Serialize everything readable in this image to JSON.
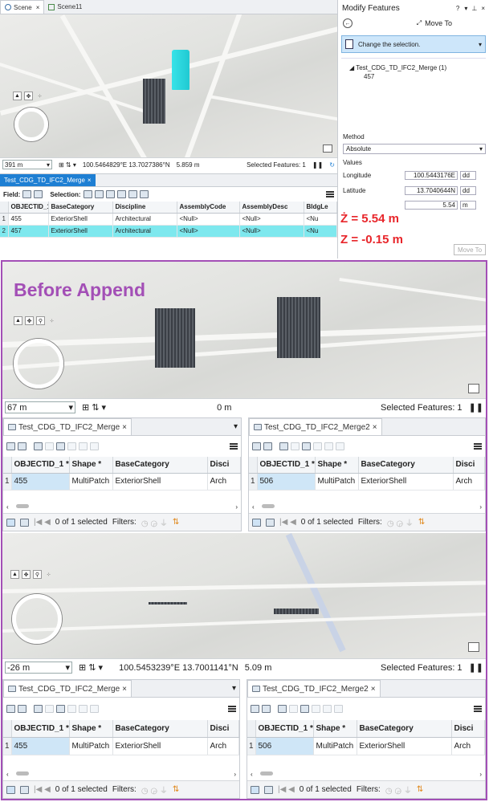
{
  "top": {
    "tabs": [
      "Scene",
      "Scene11"
    ],
    "scale": "391 m",
    "coords": "100.5464829°E 13.7027386°N",
    "elev": "5.859 m",
    "selected": "Selected Features: 1",
    "attr_tab": "Test_CDG_TD_IFC2_Merge",
    "field_label": "Field:",
    "selection_label": "Selection:",
    "columns": [
      "OBJECTID_1 *",
      "BaseCategory",
      "Discipline",
      "AssemblyCode",
      "AssemblyDesc",
      "BldgLe"
    ],
    "rows": [
      {
        "n": "1",
        "cells": [
          "455",
          "ExteriorShell",
          "Architectural",
          "<Null>",
          "<Null>",
          "<Nu"
        ]
      },
      {
        "n": "2",
        "cells": [
          "457",
          "ExteriorShell",
          "Architectural",
          "<Null>",
          "<Null>",
          "<Nu"
        ]
      }
    ]
  },
  "modify": {
    "title": "Modify Features",
    "tool": "Move To",
    "help": "?",
    "instruction": "Change the selection.",
    "layer": "Test_CDG_TD_IFC2_Merge (1)",
    "feature": "457",
    "method_label": "Method",
    "method": "Absolute",
    "values_label": "Values",
    "lon_label": "Longitude",
    "lon": "100.5443176E",
    "lat_label": "Latitude",
    "lat": "13.7040644N",
    "z": "5.54",
    "unit": "dd",
    "zunit": "m",
    "move_button": "Move To"
  },
  "annotations": {
    "z1": "Ż = 5.54 m",
    "z2": "Z = -0.15 m",
    "before": "Before Append"
  },
  "mid": {
    "scale": "67 m",
    "elev": "0 m",
    "selected": "Selected Features: 1"
  },
  "bottom": {
    "scale": "-26 m",
    "coords": "100.5453239°E 13.7001141°N",
    "elev": "5.09 m",
    "selected": "Selected Features: 1"
  },
  "tables": {
    "left_tab": "Test_CDG_TD_IFC2_Merge",
    "right_tab": "Test_CDG_TD_IFC2_Merge2",
    "columns": [
      "OBJECTID_1 *",
      "Shape *",
      "BaseCategory",
      "Disci"
    ],
    "left_row": [
      "455",
      "MultiPatch",
      "ExteriorShell",
      "Arch"
    ],
    "right_row": [
      "506",
      "MultiPatch",
      "ExteriorShell",
      "Arch"
    ],
    "row_num": "1",
    "status": "0 of 1 selected",
    "filters": "Filters:"
  },
  "colors": {
    "accent": "#1e7fd3",
    "annotation": "#e8262b",
    "frame": "#a34fb6",
    "highlight": "#7ee8ee"
  }
}
